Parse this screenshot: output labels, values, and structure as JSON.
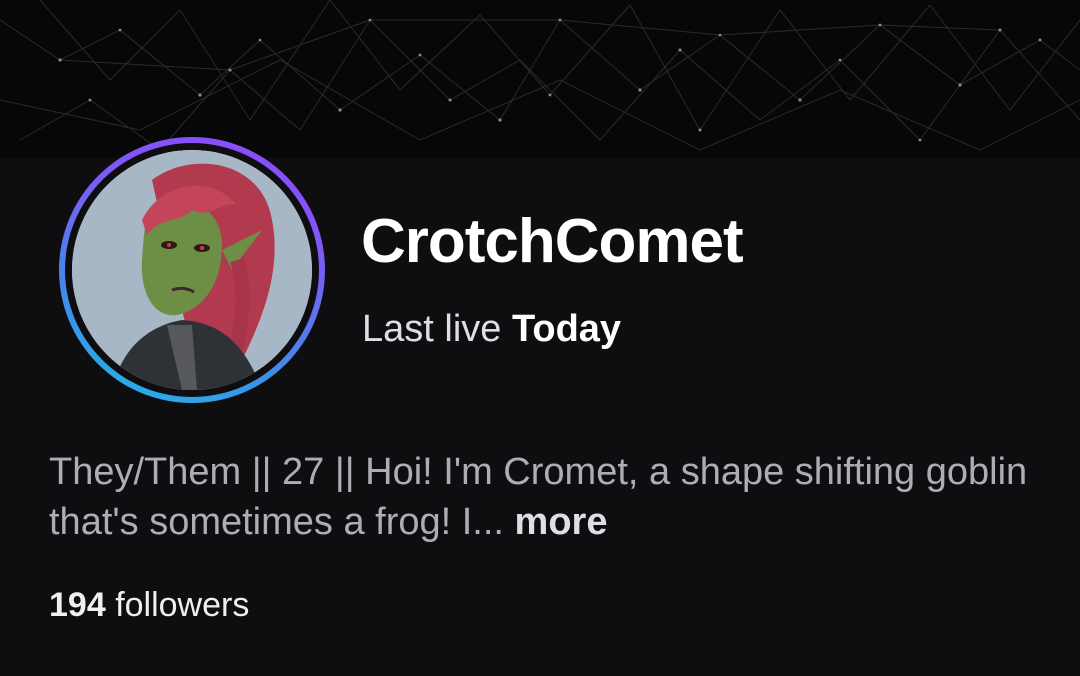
{
  "channel": {
    "username": "CrotchComet",
    "last_live_prefix": "Last live",
    "last_live_value": "Today",
    "bio_text": "They/Them || 27 || Hoi! I'm Cromet, a shape shifting goblin that's sometimes a frog! I...",
    "bio_more_label": "more",
    "followers_count": "194",
    "followers_label": "followers"
  },
  "colors": {
    "background": "#0e0e10",
    "avatar_ring_start": "#9147ff",
    "avatar_ring_end": "#1fb9e6",
    "text_primary": "#ffffff",
    "text_secondary": "#adadb8"
  }
}
